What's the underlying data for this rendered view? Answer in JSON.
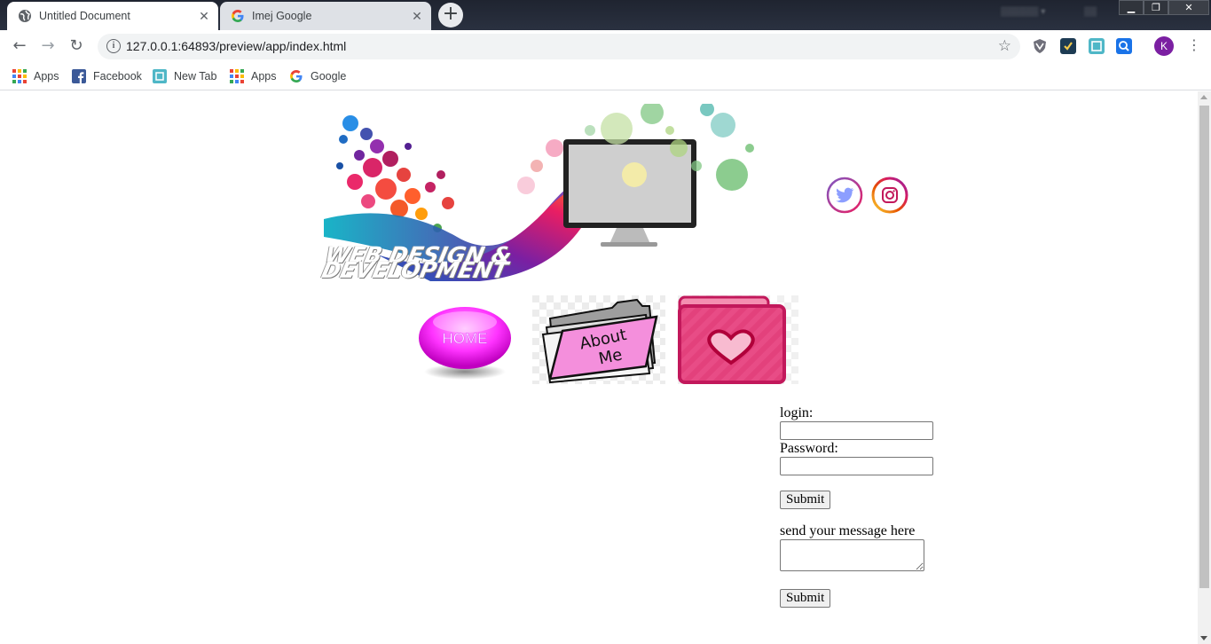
{
  "browser": {
    "tabs": [
      {
        "title": "Untitled Document",
        "active": true,
        "icon": "globe-icon"
      },
      {
        "title": "Imej Google",
        "active": false,
        "icon": "google-icon"
      }
    ],
    "new_tab_label": "+",
    "url": "127.0.0.1:64893/preview/app/index.html",
    "profile_initial": "K",
    "bookmarks": [
      {
        "label": "Apps",
        "icon": "apps-grid-icon"
      },
      {
        "label": "Facebook",
        "icon": "facebook-icon"
      },
      {
        "label": "New Tab",
        "icon": "new-tab-icon"
      },
      {
        "label": "Apps",
        "icon": "apps-grid-icon"
      },
      {
        "label": "Google",
        "icon": "google-icon"
      }
    ],
    "accent_color": "#7b1fa2"
  },
  "page": {
    "banner": {
      "line1": "WEB DESIGN &",
      "line2": "DEVELOPMENT"
    },
    "social": [
      {
        "name": "twitter-icon"
      },
      {
        "name": "instagram-icon"
      }
    ],
    "nav": {
      "home_label": "HOME",
      "about_label_line1": "About",
      "about_label_line2": "Me"
    },
    "form": {
      "login_label": "login:",
      "password_label": "Password:",
      "submit_label": "Submit",
      "message_label": "send your message here",
      "submit2_label": "Submit"
    }
  }
}
